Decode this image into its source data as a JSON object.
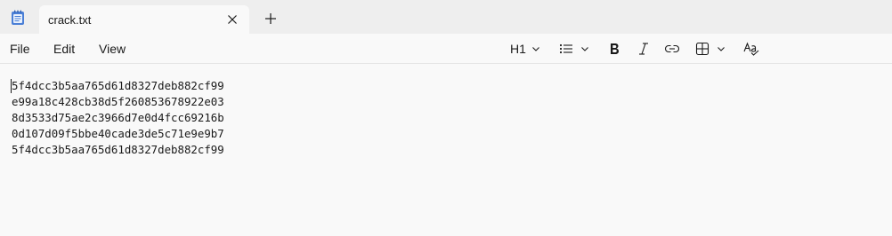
{
  "tab": {
    "title": "crack.txt",
    "close_icon": "close-icon",
    "new_tab_icon": "plus-icon"
  },
  "menu": {
    "file": "File",
    "edit": "Edit",
    "view": "View"
  },
  "toolbar": {
    "heading": "H1",
    "icons": [
      "list-icon",
      "bold-icon",
      "italic-icon",
      "link-icon",
      "table-icon",
      "spellcheck-icon"
    ]
  },
  "document": {
    "lines": [
      "5f4dcc3b5aa765d61d8327deb882cf99",
      "e99a18c428cb38d5f260853678922e03",
      "8d3533d75ae2c3966d7e0d4fcc69216b",
      "0d107d09f5bbe40cade3de5c71e9e9b7",
      "5f4dcc3b5aa765d61d8327deb882cf99"
    ]
  },
  "colors": {
    "tabstrip": "#eeeeee",
    "surface": "#f9f9f9",
    "text": "#1a1a1a",
    "notepad_blue": "#4a7fd6"
  }
}
